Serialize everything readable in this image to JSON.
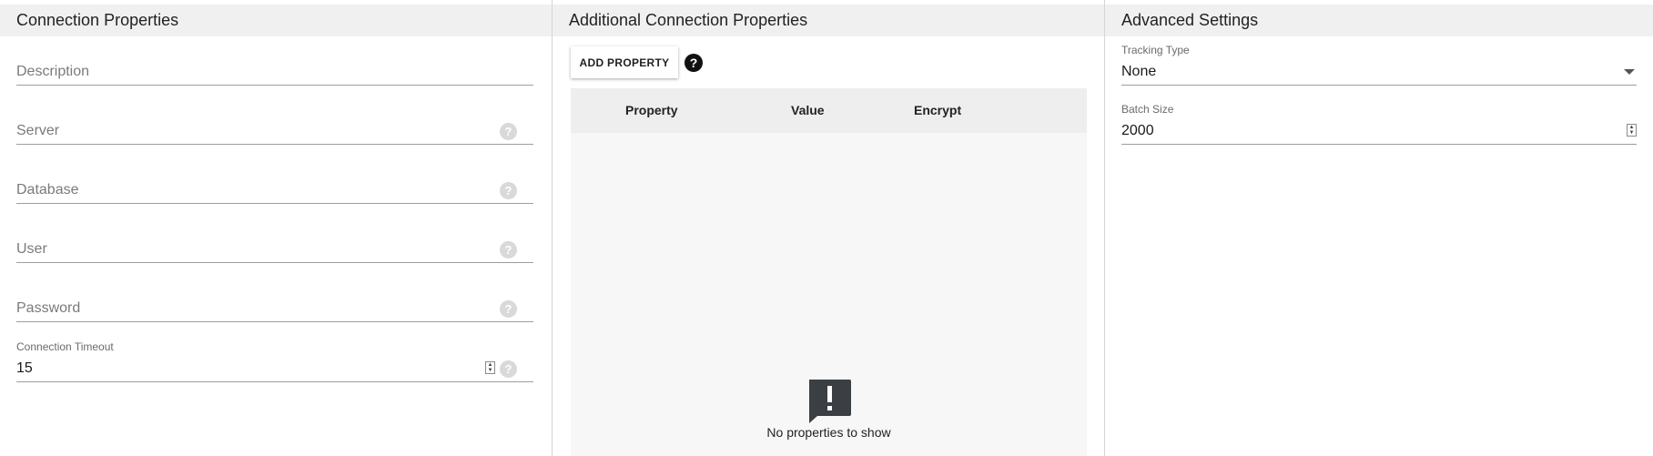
{
  "connection_properties": {
    "title": "Connection Properties",
    "description_placeholder": "Description",
    "server_placeholder": "Server",
    "database_placeholder": "Database",
    "user_placeholder": "User",
    "password_placeholder": "Password",
    "timeout_label": "Connection Timeout",
    "timeout_value": "15",
    "help_glyph": "?"
  },
  "additional_properties": {
    "title": "Additional Connection Properties",
    "add_button": "ADD PROPERTY",
    "help_glyph": "?",
    "columns": [
      "Property",
      "Value",
      "Encrypt"
    ],
    "empty_message": "No properties to show",
    "empty_icon": "exclamation-speech-bubble-icon"
  },
  "advanced_settings": {
    "title": "Advanced Settings",
    "tracking_type_label": "Tracking Type",
    "tracking_type_value": "None",
    "batch_size_label": "Batch Size",
    "batch_size_value": "2000"
  }
}
